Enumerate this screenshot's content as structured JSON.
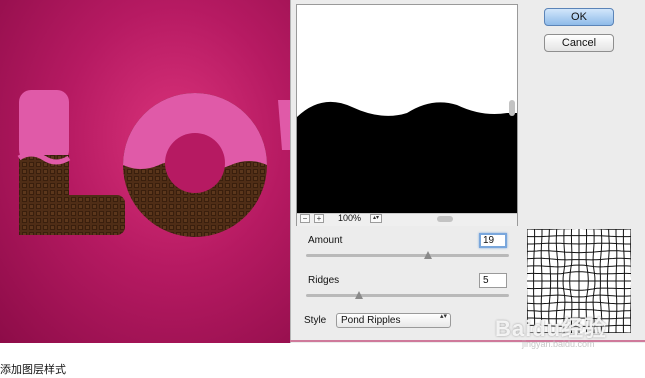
{
  "canvas": {
    "artwork_text": "LOV",
    "colors": {
      "background": "#b61a62",
      "icing": "#e05aa8",
      "chocolate": "#4b2c16"
    }
  },
  "dialog": {
    "ok_label": "OK",
    "cancel_label": "Cancel",
    "zoom_out_icon": "−",
    "zoom_in_icon": "+",
    "zoom_level": "100%",
    "zoom_stepper_icon": "▴▾",
    "controls": {
      "amount_label": "Amount",
      "amount_value": "19",
      "amount_slider_fraction": 0.6,
      "ridges_label": "Ridges",
      "ridges_value": "5",
      "ridges_slider_fraction": 0.26,
      "style_label": "Style",
      "style_value": "Pond Ripples",
      "style_arrow_icon": "▴▾"
    },
    "accent_color": "#5b84b8"
  },
  "watermark": {
    "brand": "Baidu经验",
    "sub": "jingyan.baidu.com"
  },
  "caption": "添加图层样式"
}
